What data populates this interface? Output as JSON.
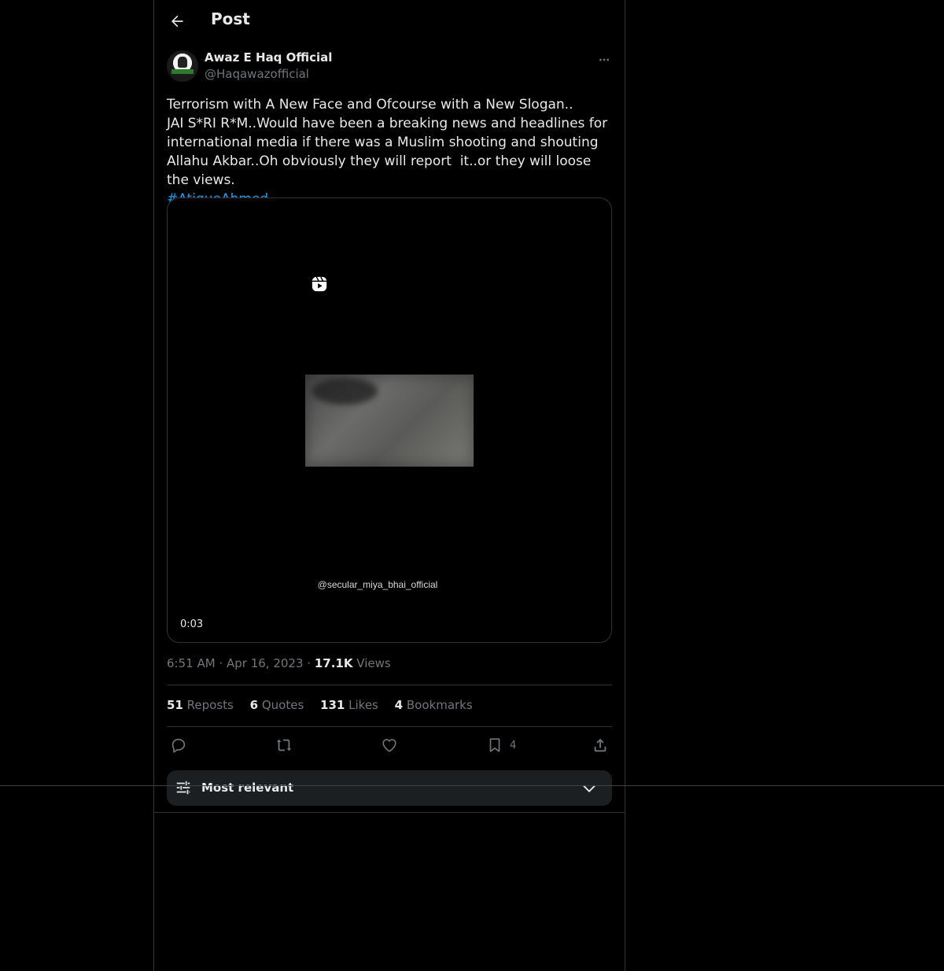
{
  "header": {
    "title": "Post",
    "back_icon": "arrow-left-icon"
  },
  "post": {
    "author_name": "Awaz E Haq Official",
    "author_handle": "@Haqawazofficial",
    "avatar_text": "AWAZ E HAQ",
    "text": "Terrorism with A New Face and Ofcourse with a New Slogan..\nJAI S*RI R*M..Would have been a breaking news and headlines for international media if there was a Muslim shooting and shouting Allahu Akbar..Oh obviously they will report  it..or they will loose the views.",
    "hashtag": "#AtiqueAhmed",
    "media": {
      "watermark": "@secular_miya_bhai_official",
      "duration": "0:03"
    },
    "time": "6:51 AM",
    "date": "Apr 16, 2023",
    "separator": "·",
    "views_count": "17.1K",
    "views_label": "Views",
    "stats": {
      "reposts_count": "51",
      "reposts_label": "Reposts",
      "quotes_count": "6",
      "quotes_label": "Quotes",
      "likes_count": "131",
      "likes_label": "Likes",
      "bookmarks_count": "4",
      "bookmarks_label": "Bookmarks"
    },
    "actions": {
      "reply_icon": "reply-icon",
      "repost_icon": "repost-icon",
      "like_icon": "heart-icon",
      "bookmark_icon": "bookmark-icon",
      "bookmark_count": "4",
      "share_icon": "share-icon"
    }
  },
  "replies_sort": {
    "label": "Most relevant",
    "icon": "sliders-icon",
    "chevron": "chevron-down-icon"
  },
  "colors": {
    "background": "#000000",
    "text": "#e7e9ea",
    "secondary_text": "#71767b",
    "link": "#1d9bf0",
    "border": "#2f3336",
    "sort_bg": "#1c1f22"
  }
}
